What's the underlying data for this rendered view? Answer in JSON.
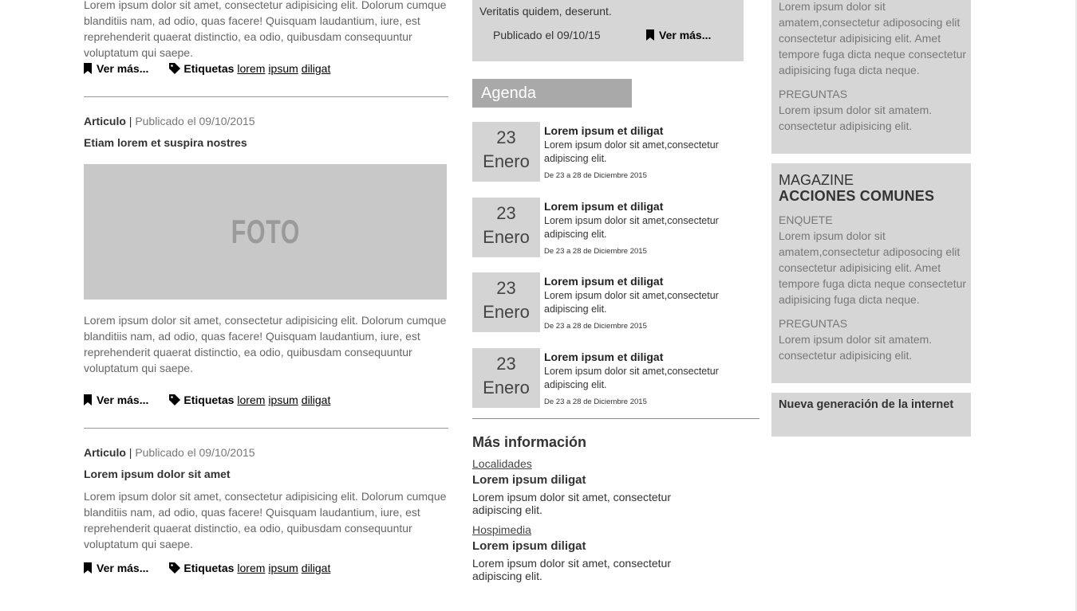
{
  "articles": {
    "lead_text": "Lorem ipsum dolor sit amet, consectetur adipisicing elit. Dolorum cumque blanditiis nam, ad odio, quas facere! Quisquam laudantium, iure, est reprehenderit quaerat distinctio, ea odio, quibusdam consequuntur voluptatum qui saepe.",
    "more_label": "Ver más...",
    "tags_label": "Etiquetas",
    "tags": [
      "lorem",
      "ipsum",
      "diligat"
    ],
    "items": [
      {
        "kind": "Articulo",
        "separator": "|",
        "published": "Publicado el 09/10/2015",
        "title": "Etiam lorem et suspira nostres",
        "photo_label": "FOTO",
        "body": "Lorem ipsum dolor sit amet, consectetur adipisicing elit. Dolorum cumque blanditiis nam, ad odio, quas facere! Quisquam laudantium, iure, est reprehenderit quaerat distinctio, ea odio, quibusdam consequuntur voluptatum qui saepe."
      },
      {
        "kind": "Articulo",
        "separator": "|",
        "published": "Publicado el 09/10/2015",
        "title": "Lorem ipsum dolor sit amet",
        "body": "Lorem ipsum dolor sit amet, consectetur adipisicing elit. Dolorum cumque blanditiis nam, ad odio, quas facere! Quisquam laudantium, iure, est reprehenderit quaerat distinctio, ea odio, quibusdam consequuntur voluptatum qui saepe."
      }
    ]
  },
  "featured": {
    "text": "Veritatis quidem, deserunt.",
    "published": "Publicado el 09/10/15",
    "more_label": "Ver más..."
  },
  "agenda": {
    "title": "Agenda",
    "events": [
      {
        "day": "23",
        "month": "Enero",
        "title": "Lorem ipsum et diligat",
        "desc": "Lorem ipsum dolor sit amet,consectetur adipiscing elit.",
        "range": "De 23 a 28 de Diciembre 2015"
      },
      {
        "day": "23",
        "month": "Enero",
        "title": "Lorem ipsum et diligat",
        "desc": "Lorem ipsum dolor sit amet,consectetur adipiscing elit.",
        "range": "De 23 a 28 de Diciembre 2015"
      },
      {
        "day": "23",
        "month": "Enero",
        "title": "Lorem ipsum et diligat",
        "desc": "Lorem ipsum dolor sit amet,consectetur adipiscing elit.",
        "range": "De 23 a 28 de Diciembre 2015"
      },
      {
        "day": "23",
        "month": "Enero",
        "title": "Lorem ipsum et diligat",
        "desc": "Lorem ipsum dolor sit amet,consectetur adipiscing elit.",
        "range": "De 23 a 28 de Diciembre 2015"
      }
    ]
  },
  "more_info": {
    "title": "Más información",
    "items": [
      {
        "link": "Localidades",
        "heading": "Lorem ipsum diligat",
        "text": "Lorem ipsum dolor sit amet, consectetur adipiscing elit."
      },
      {
        "link": "Hospimedia",
        "heading": "Lorem ipsum diligat",
        "text": "Lorem ipsum dolor sit amet, consectetur adipiscing elit."
      }
    ]
  },
  "sidebar": {
    "top_box": {
      "text": "Lorem ipsum dolor sit amatem,consectetur adiposocing elit consectetur adipisicing elit. Amet tempore fuga dicta neque consectetur adipisicing fuga dicta neque.",
      "label": "PREGUNTAS",
      "label_text": "Lorem ipsum dolor sit amatem. consectetur adipisicing elit."
    },
    "magazine": {
      "title": "MAGAZINE",
      "subtitle": "ACCIONES COMUNES",
      "label1": "ENQUETE",
      "text1": "Lorem ipsum dolor sit amatem,consectetur adiposocing elit consectetur adipisicing elit. Amet tempore fuga dicta neque consectetur adipisicing fuga dicta neque.",
      "label2": "PREGUNTAS",
      "text2": "Lorem ipsum dolor sit amatem. consectetur adipisicing elit."
    },
    "next_gen": "Nueva generación de la internet"
  }
}
